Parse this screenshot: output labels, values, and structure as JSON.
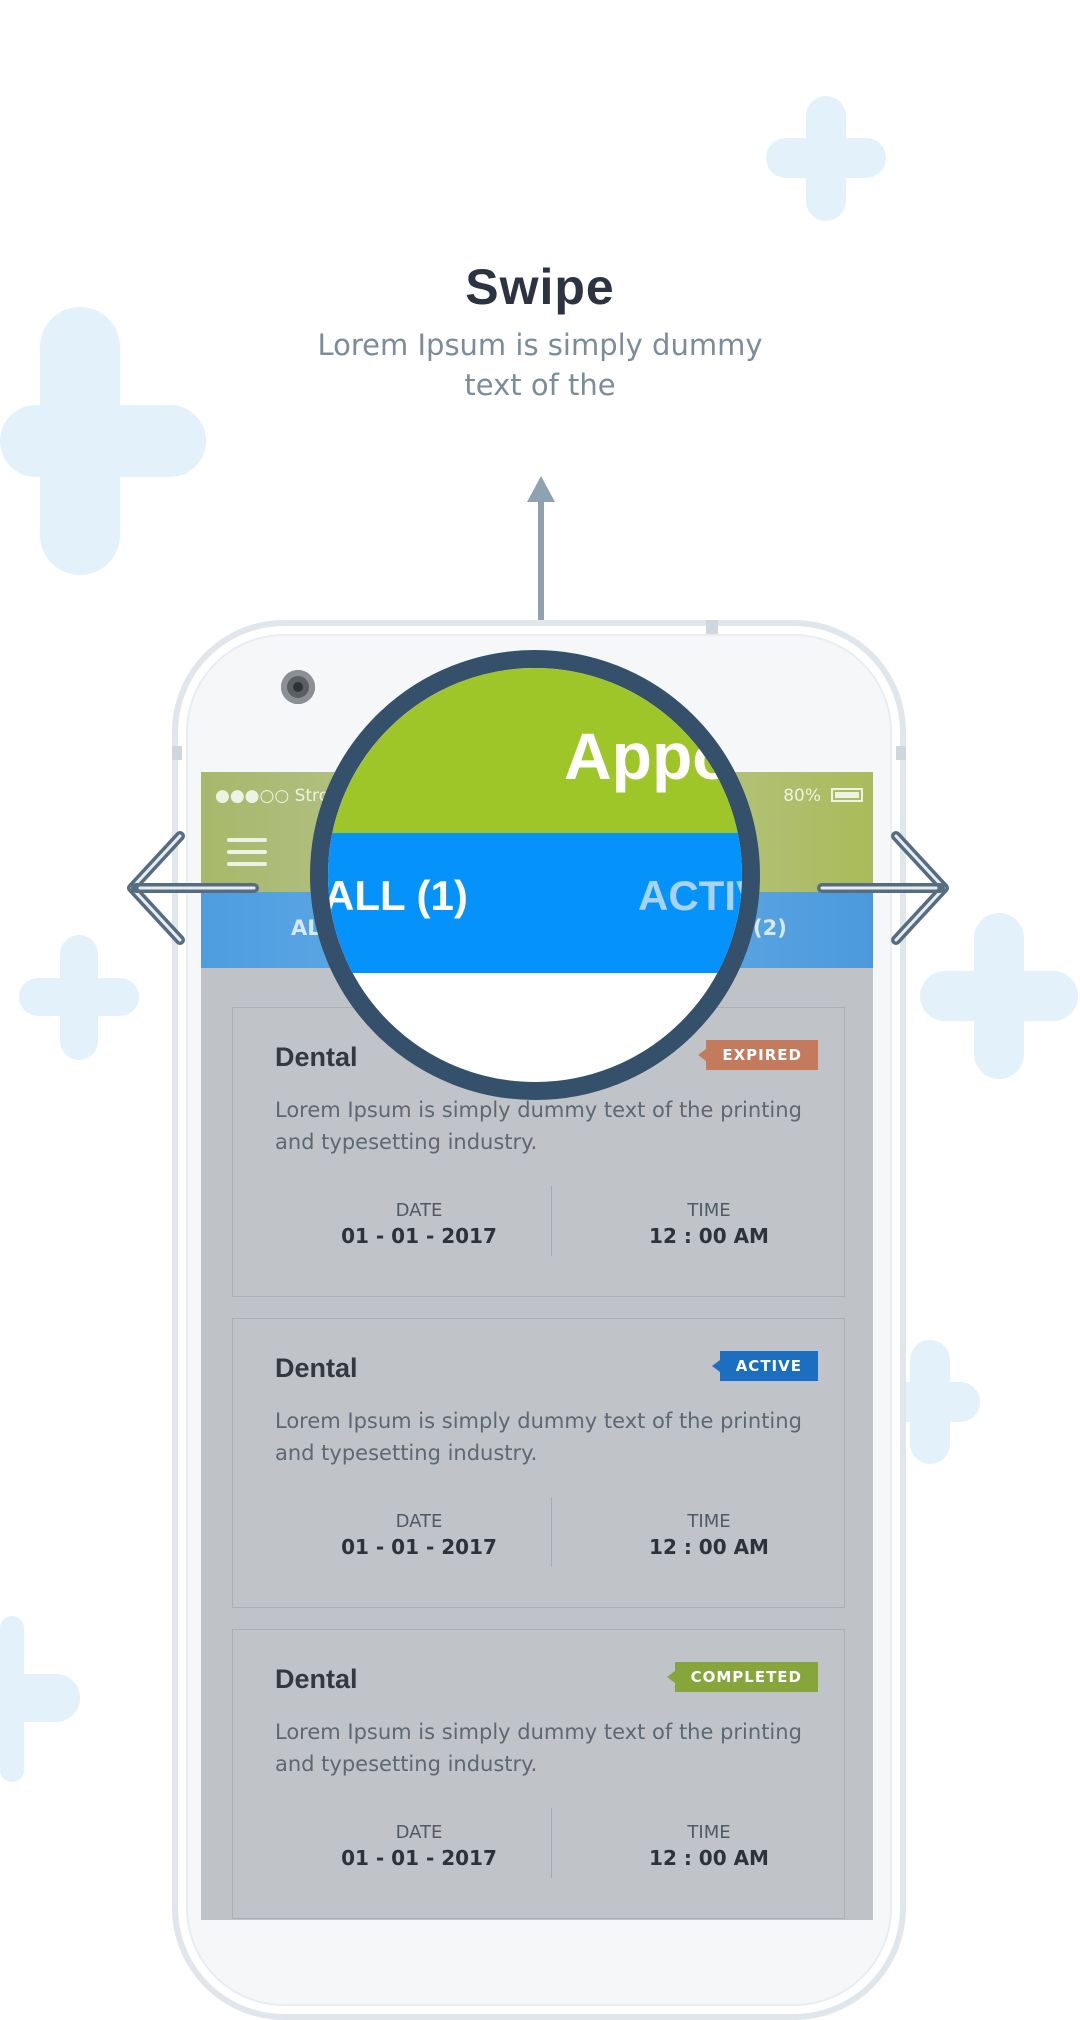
{
  "header": {
    "title": "Swipe",
    "subtitle": "Lorem Ipsum is simply dummy text of the"
  },
  "magnifier": {
    "app_title": "Appo",
    "tab_all": "ALL (1)",
    "tab_active": "ACTIV"
  },
  "phone": {
    "status_carrier": "●●●○○ Strok",
    "status_battery": "80%",
    "tabs": [
      "AL",
      "(2)"
    ]
  },
  "cards": [
    {
      "title": "Dental",
      "badge": "EXPIRED",
      "description": "Lorem Ipsum is simply dummy text of the printing and typesetting industry.",
      "date_label": "DATE",
      "date_value": "01 - 01 - 2017",
      "time_label": "TIME",
      "time_value": "12 : 00 AM"
    },
    {
      "title": "Dental",
      "badge": "ACTIVE",
      "description": "Lorem Ipsum is simply dummy text of the printing and typesetting industry.",
      "date_label": "DATE",
      "date_value": "01 - 01 - 2017",
      "time_label": "TIME",
      "time_value": "12 : 00 AM"
    },
    {
      "title": "Dental",
      "badge": "COMPLETED",
      "description": "Lorem Ipsum is simply dummy text of the printing and typesetting industry.",
      "date_label": "DATE",
      "date_value": "01 - 01 - 2017",
      "time_label": "TIME",
      "time_value": "12 : 00 AM"
    }
  ],
  "colors": {
    "accent_green": "#9ec628",
    "accent_blue": "#0593fb",
    "magnifier_ring": "#34506a",
    "badge_expired": "#c47a5c",
    "badge_active": "#1c6fc0",
    "badge_completed": "#86a53a",
    "decor_plus": "#e3f1fa"
  },
  "icons": [
    "menu-icon",
    "battery-icon",
    "camera-icon",
    "swipe-up-arrow-icon",
    "swipe-left-arrow-icon",
    "swipe-right-arrow-icon",
    "plus-decor-icon"
  ]
}
